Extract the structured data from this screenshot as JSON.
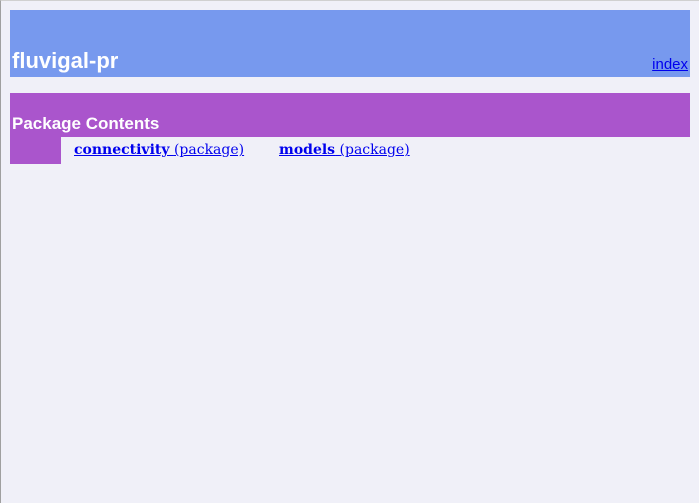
{
  "heading": {
    "title": "fluvigal-pr",
    "index_link": "index"
  },
  "section": {
    "title": "Package Contents",
    "packages": [
      {
        "name": "connectivity",
        "kind": "(package)"
      },
      {
        "name": "models",
        "kind": "(package)"
      }
    ]
  },
  "colors": {
    "page_background": "#f0f0f8",
    "heading_background": "#7799ee",
    "section_background": "#aa55cc",
    "link": "#0000ee",
    "heading_text": "#ffffff"
  }
}
